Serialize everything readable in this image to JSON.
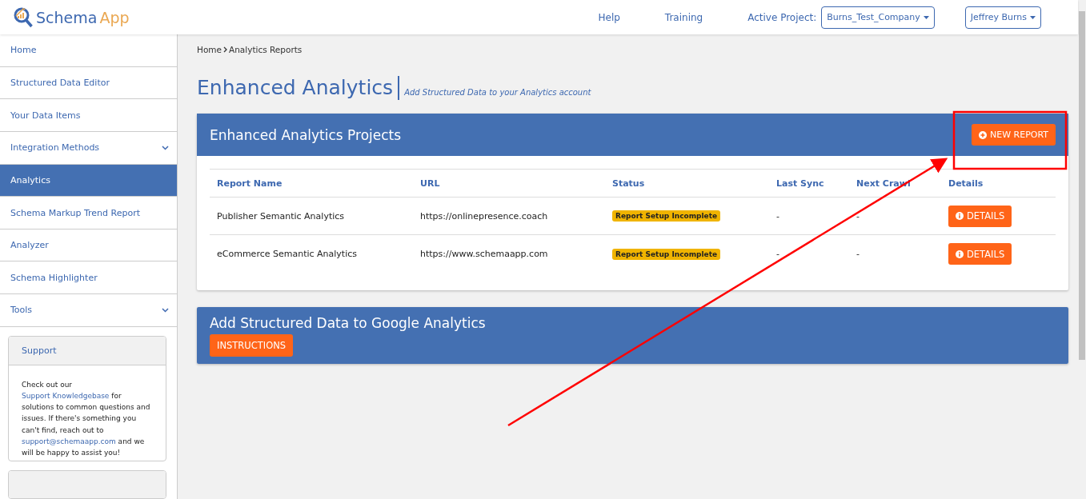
{
  "header": {
    "logo": {
      "word_1": "Schema",
      "word_2": "App"
    },
    "links": [
      "Help",
      "Training"
    ],
    "project_label": "Active Project:",
    "project": "Burns_Test_Company",
    "user": "Jeffrey Burns"
  },
  "sidebar": {
    "items": [
      {
        "label": "Home",
        "selected": false,
        "expandable": false
      },
      {
        "label": "Structured Data Editor",
        "selected": false,
        "expandable": false
      },
      {
        "label": "Your Data Items",
        "selected": false,
        "expandable": false
      },
      {
        "label": "Integration Methods",
        "selected": false,
        "expandable": true
      },
      {
        "label": "Analytics",
        "selected": true,
        "expandable": false
      },
      {
        "label": "Schema Markup Trend Report",
        "selected": false,
        "expandable": false
      },
      {
        "label": "Analyzer",
        "selected": false,
        "expandable": false
      },
      {
        "label": "Schema Highlighter",
        "selected": false,
        "expandable": false
      },
      {
        "label": "Tools",
        "selected": false,
        "expandable": true
      }
    ],
    "support": {
      "title": "Support",
      "text": [
        {
          "text": "Check out our ",
          "link": false
        },
        {
          "text": "Support Knowledgebase",
          "link": true
        },
        {
          "text": " for solutions to common questions and issues. If there's something you can't find, reach out to ",
          "link": false
        },
        {
          "text": "support@schemaapp.com",
          "link": true
        },
        {
          "text": " and we will be happy to assist you!",
          "link": false
        }
      ]
    }
  },
  "breadcrumb": [
    "Home",
    "Analytics Reports"
  ],
  "page_title": "Enhanced Analytics",
  "page_subtitle": "Add Structured Data to your Analytics account",
  "projects_panel": {
    "title": "Enhanced Analytics Projects",
    "new_button": "NEW REPORT",
    "table": {
      "columns": [
        "Report Name",
        "URL",
        "Status",
        "Last Sync",
        "Next Crawl",
        "Details"
      ],
      "rows": [
        {
          "name": "Publisher Semantic Analytics",
          "url": "https://onlinepresence.coach",
          "status": "Report Setup Incomplete",
          "last_sync": "-",
          "next_crawl": "-",
          "button": "DETAILS"
        },
        {
          "name": "eCommerce Semantic Analytics",
          "url": "https://www.schemaapp.com",
          "status": "Report Setup Incomplete",
          "last_sync": "-",
          "next_crawl": "-",
          "button": "DETAILS"
        }
      ]
    }
  },
  "instructions_panel": {
    "title": "Add Structured Data to Google Analytics",
    "button": "INSTRUCTIONS"
  }
}
